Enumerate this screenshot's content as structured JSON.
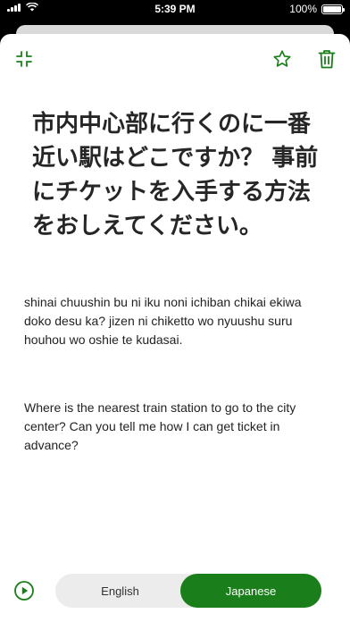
{
  "status_bar": {
    "time": "5:39 PM",
    "battery": "100%"
  },
  "icons": {
    "collapse": "collapse-icon",
    "star": "star-icon",
    "trash": "trash-icon",
    "play": "play-icon"
  },
  "phrase": {
    "japanese": "市内中心部に行くのに一番近い駅はどこですか？ 事前にチケットを入手する方法をおしえてください。",
    "romaji": "shinai chuushin bu ni iku noni ichiban chikai ekiwa doko desu ka? jizen ni chiketto wo nyuushu suru houhou wo oshie te kudasai.",
    "english": "Where is the nearest train station to go to the city center? Can you tell me how I can get ticket in advance?"
  },
  "language_toggle": {
    "english_label": "English",
    "japanese_label": "Japanese",
    "selected": "Japanese"
  },
  "colors": {
    "accent": "#1a7f1a",
    "toggle_bg": "#ececec"
  }
}
